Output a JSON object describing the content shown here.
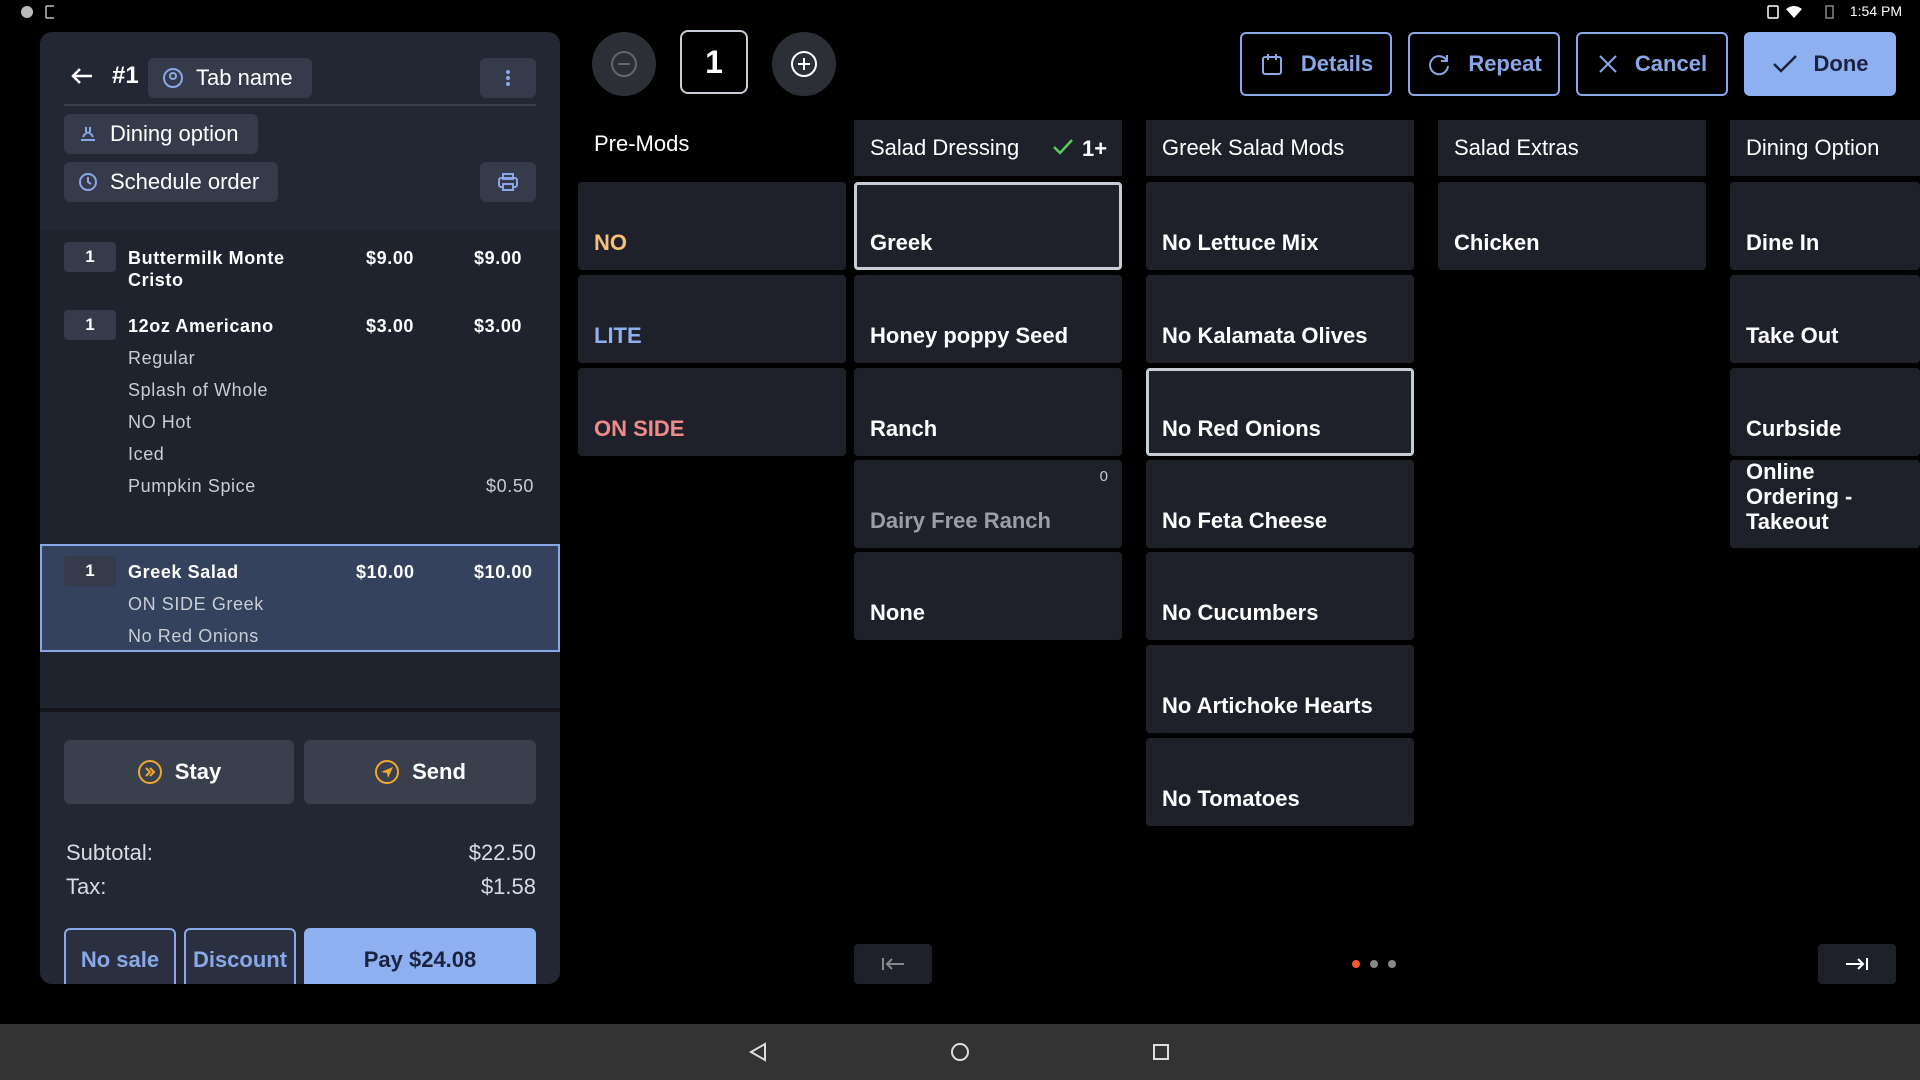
{
  "status": {
    "time": "1:54 PM"
  },
  "order": {
    "number": "#1",
    "tab_name": "Tab name",
    "dining_option": "Dining option",
    "schedule_order": "Schedule order",
    "items": [
      {
        "qty": "1",
        "name": "Buttermilk Monte",
        "name2": "Cristo",
        "price": "$9.00",
        "total": "$9.00"
      },
      {
        "qty": "1",
        "name": "12oz Americano",
        "price": "$3.00",
        "total": "$3.00",
        "mods": [
          "Regular",
          "Splash of Whole",
          "NO Hot",
          "Iced",
          "Pumpkin Spice"
        ],
        "mod_price": "$0.50"
      },
      {
        "qty": "1",
        "name": "Greek Salad",
        "price": "$10.00",
        "total": "$10.00",
        "mods": [
          "ON SIDE Greek",
          "No Red Onions"
        ]
      }
    ],
    "stay_label": "Stay",
    "send_label": "Send",
    "subtotal_label": "Subtotal:",
    "subtotal": "$22.50",
    "tax_label": "Tax:",
    "tax": "$1.58",
    "no_sale": "No sale",
    "discount": "Discount",
    "pay": "Pay $24.08"
  },
  "toolbar": {
    "quantity": "1",
    "details": "Details",
    "repeat": "Repeat",
    "cancel": "Cancel",
    "done": "Done"
  },
  "columns": {
    "premods": {
      "title": "Pre-Mods",
      "items": [
        "NO",
        "LITE",
        "ON SIDE"
      ],
      "colors": [
        "#f4c07a",
        "#8fb0f0",
        "#f08a8a"
      ]
    },
    "dressing": {
      "title": "Salad Dressing",
      "req": "1+",
      "items": [
        "Greek",
        "Honey poppy Seed",
        "Ranch",
        "Dairy Free Ranch",
        "None"
      ],
      "count": "0"
    },
    "greek": {
      "title": "Greek Salad Mods",
      "items": [
        "No Lettuce Mix",
        "No Kalamata Olives",
        "No Red Onions",
        "No Feta Cheese",
        "No Cucumbers",
        "No Artichoke Hearts",
        "No Tomatoes"
      ]
    },
    "extras": {
      "title": "Salad Extras",
      "items": [
        "Chicken"
      ]
    },
    "dining": {
      "title": "Dining Option",
      "items": [
        "Dine In",
        "Take Out",
        "Curbside",
        "Online Ordering -",
        "Takeout"
      ]
    }
  }
}
